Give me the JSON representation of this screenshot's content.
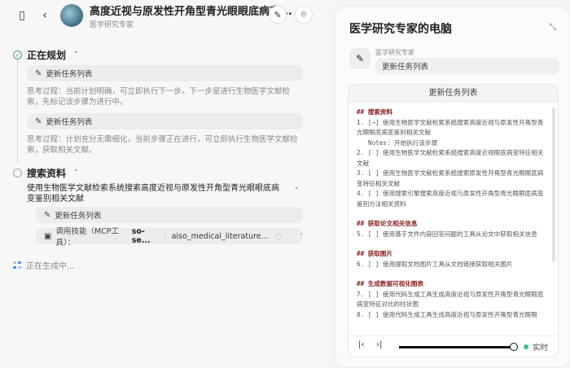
{
  "header": {
    "title": "高度近视与原发性开角型青光眼眼底病变...",
    "subtitle": "医学研究专家"
  },
  "steps": [
    {
      "title": "正在规划",
      "status": "done",
      "items": [
        {
          "action": "更新任务列表",
          "thought": "思考过程：当前计划明确，可立即执行下一步。下一步是进行生物医学文献检索，先标记该步骤为进行中。"
        },
        {
          "action": "更新任务列表",
          "thought": "思考过程：计划充分无需细化，当前步骤正在进行，可立即执行生物医学文献检索，获取相关文献。"
        }
      ]
    },
    {
      "title": "搜索资料",
      "status": "pending",
      "task": "使用生物医学文献检索系统搜索高度近视与原发性开角型青光眼眼底病变鉴别相关文献",
      "action": "更新任务列表",
      "skill_label": "调用技能（MCP工具）：",
      "skill_server": "so-se...",
      "skill_tool": "aiso_medical_literature..."
    }
  ],
  "generating": "正在生成中...",
  "panel": {
    "title": "医学研究专家的电脑",
    "agent": "医学研究专家",
    "agent_action": "更新任务列表",
    "box_title": "更新任务列表",
    "lines": [
      {
        "t": "h",
        "v": "## 搜索资料"
      },
      {
        "t": "l",
        "v": "1. [→] 使用生物医学文献检索系统搜索高度近视与原发性开角型青光眼眼底病变鉴别相关文献"
      },
      {
        "t": "n",
        "v": "Notes: 开始执行该步骤"
      },
      {
        "t": "l",
        "v": "2. [ ] 使用生物医学文献检索系统搜索高度近视眼底病变特征相关文献"
      },
      {
        "t": "l",
        "v": "3. [ ] 使用生物医学文献检索系统搜索原发性开角型青光眼眼底病变特征相关文献"
      },
      {
        "t": "l",
        "v": "4. [ ] 使用搜索引擎搜索高度近视与原发性开角型青光眼眼底病变鉴别方法相关资料"
      },
      {
        "t": "g",
        "v": ""
      },
      {
        "t": "h",
        "v": "## 获取论文相关信息"
      },
      {
        "t": "l",
        "v": "5. [ ] 使用基于文件内容回答问题的工具从论文中获取相关信息"
      },
      {
        "t": "g",
        "v": ""
      },
      {
        "t": "h",
        "v": "## 获取图片"
      },
      {
        "t": "l",
        "v": "6. [ ] 使用提取文档图片工具从文档链接获取相关图片"
      },
      {
        "t": "g",
        "v": ""
      },
      {
        "t": "h",
        "v": "## 生成数据可视化图表"
      },
      {
        "t": "l",
        "v": "7. [ ] 使用代码生成工具生成高度近视与原发性开角型青光眼眼底病变特征对比的柱状图"
      },
      {
        "t": "l",
        "v": "8. [ ] 使用代码生成工具生成高度近视与原发性开角型青光眼眼"
      }
    ],
    "playback_progress": 1.0,
    "live_label": "实时"
  },
  "colors": {
    "accent_done": "#3aa58a",
    "heading": "#8b1e1e",
    "live": "#3cc08a"
  }
}
